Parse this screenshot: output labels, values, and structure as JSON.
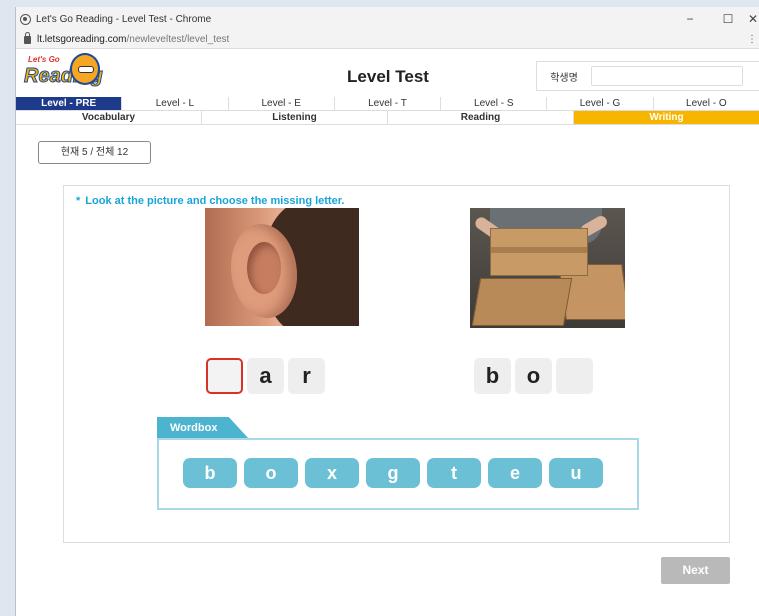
{
  "browser": {
    "title": "Let's Go Reading - Level Test - Chrome",
    "url_domain": "lt.letsgoreading.com",
    "url_path": "/newleveltest/level_test",
    "controls": {
      "minimize": "−",
      "maximize": "☐",
      "close": "✕"
    },
    "menu": "⋮"
  },
  "logo": {
    "small": "Let's Go",
    "big": "Reading"
  },
  "header": {
    "title": "Level Test",
    "student_label": "학생명",
    "student_value": ""
  },
  "levels": [
    "Level - PRE",
    "Level - L",
    "Level - E",
    "Level - T",
    "Level - S",
    "Level - G",
    "Level - O"
  ],
  "active_level": "Level - PRE",
  "sections": [
    "Vocabulary",
    "Listening",
    "Reading",
    "Writing"
  ],
  "active_section": "Writing",
  "progress": "현재 5 / 전체 12",
  "question": {
    "star": "*",
    "instruction": "Look at the picture and choose the missing letter.",
    "word1": [
      "",
      "a",
      "r"
    ],
    "word2": [
      "b",
      "o",
      ""
    ]
  },
  "wordbox": {
    "label": "Wordbox",
    "letters": [
      "b",
      "o",
      "x",
      "g",
      "t",
      "e",
      "u"
    ]
  },
  "next_label": "Next",
  "colors": {
    "accent_blue": "#19a4d8",
    "level_active": "#1e3a8a",
    "section_active": "#f7b500",
    "tile_button": "#6cc0d6",
    "active_blank_border": "#d9302a"
  }
}
